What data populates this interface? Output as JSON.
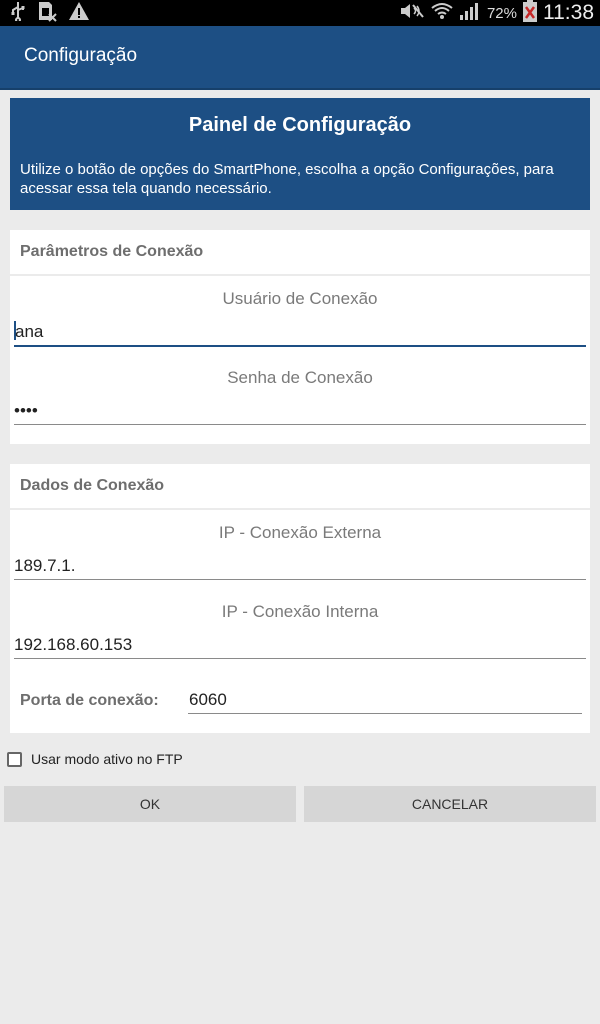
{
  "status_bar": {
    "icons_left": [
      "usb-icon",
      "sim-card-x-icon",
      "warning-icon"
    ],
    "icons_right": [
      "mute-icon",
      "wifi-icon",
      "signal-icon",
      "battery-icon"
    ],
    "battery": "72%",
    "time": "11:38"
  },
  "appbar": {
    "title": "Configuração"
  },
  "header": {
    "title": "Painel de Configuração",
    "description": "Utilize o botão de opções do SmartPhone, escolha a opção Configurações, para acessar essa tela quando necessário.",
    "color": "#1d4f84"
  },
  "connection_params": {
    "title": "Parâmetros de Conexão",
    "user_label": "Usuário de Conexão",
    "user_value": "ana",
    "password_label": "Senha de Conexão",
    "password_value": "••••"
  },
  "connection_data": {
    "title": "Dados de Conexão",
    "external_ip_label": "IP - Conexão Externa",
    "external_ip_value": "189.7.1.",
    "internal_ip_label": "IP - Conexão Interna",
    "internal_ip_value": "192.168.60.153",
    "port_label": "Porta de conexão:",
    "port_value": "6060"
  },
  "ftp_checkbox": {
    "label": "Usar modo ativo no FTP",
    "checked": false
  },
  "buttons": {
    "ok": "OK",
    "cancel": "CANCELAR"
  }
}
